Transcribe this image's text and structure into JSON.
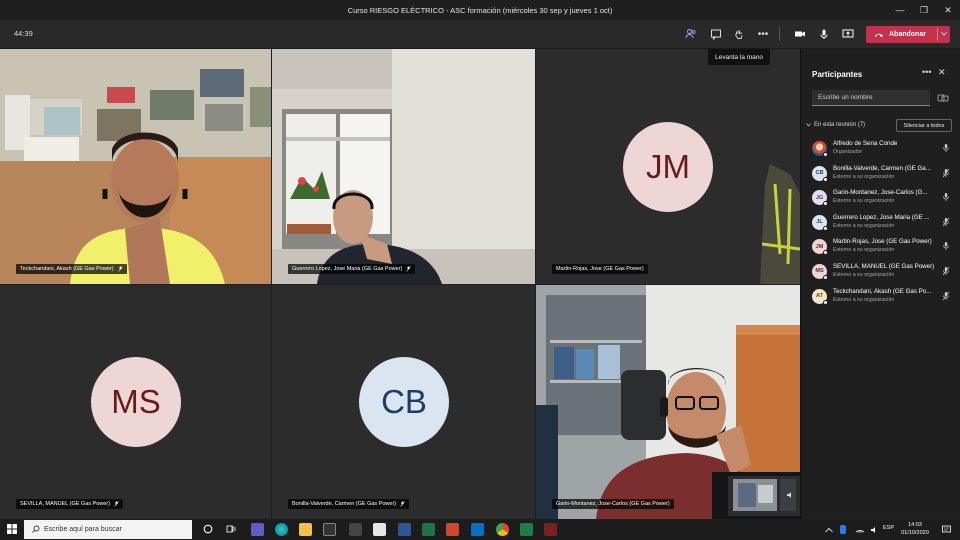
{
  "window": {
    "title": "Curso RIESGO ELÉCTRICO - ASC formación (miércoles 30 sep y jueves 1 oct)"
  },
  "toolbar": {
    "timer": "44:39",
    "leave_label": "Abandonar",
    "tooltip": "Levanta la mano"
  },
  "tiles": [
    {
      "name": "Teckchandani, Akash (GE Gas Power)",
      "type": "video"
    },
    {
      "name": "Guerrero Lopez, Jose Maria (GE Gas Power)",
      "type": "video"
    },
    {
      "name": "Martin-Rojas, Jose (GE Gas Power)",
      "type": "avatar",
      "initials": "JM"
    },
    {
      "name": "SEVILLA, MANUEL (GE Gas Power)",
      "type": "avatar",
      "initials": "MS"
    },
    {
      "name": "Bonilla-Valverde, Carmen (GE Gas Power)",
      "type": "avatar",
      "initials": "CB"
    },
    {
      "name": "Garin-Montanez, Jose-Carlos (GE Gas Power)",
      "type": "video"
    }
  ],
  "panel": {
    "title": "Participantes",
    "search_placeholder": "Escribe un nombre",
    "section_label": "En esta reunión (7)",
    "mute_all_label": "Silenciar a todos",
    "participants": [
      {
        "initials": "",
        "name": "Alfredo de Sena Conde",
        "role": "Organizador",
        "avatar_color": "#f0d9c4",
        "text_color": "#8a3a1a",
        "mic": "on"
      },
      {
        "initials": "CB",
        "name": "Bonilla-Valverde, Carmen (GE Ga...",
        "role": "Externo a su organización",
        "avatar_color": "#dbe5f1",
        "text_color": "#1b3d67",
        "mic": "off"
      },
      {
        "initials": "JG",
        "name": "Garin-Montanez, Jose-Carlos (G...",
        "role": "Externo a su organización",
        "avatar_color": "#e4dcf0",
        "text_color": "#4b2f7a",
        "mic": "on"
      },
      {
        "initials": "JL",
        "name": "Guerrero Lopez, Jose Maria (GE ...",
        "role": "Externo a su organización",
        "avatar_color": "#dbe5f1",
        "text_color": "#1b3d67",
        "mic": "off"
      },
      {
        "initials": "JM",
        "name": "Martin-Rojas, Jose (GE Gas Power)",
        "role": "Externo a su organización",
        "avatar_color": "#efd6d6",
        "text_color": "#6b1a1a",
        "mic": "on"
      },
      {
        "initials": "MS",
        "name": "SEVILLA, MANUEL (GE Gas Power)",
        "role": "Externo a su organización",
        "avatar_color": "#efd6d6",
        "text_color": "#6b1a1a",
        "mic": "off"
      },
      {
        "initials": "AT",
        "name": "Teckchandani, Akash (GE Gas Po...",
        "role": "Externo a su organización",
        "avatar_color": "#f3e6c9",
        "text_color": "#6b4a0a",
        "mic": "off"
      }
    ]
  },
  "taskbar": {
    "search_placeholder": "Escribe aquí para buscar",
    "time": "14:03",
    "date": "01/10/2020"
  },
  "colors": {
    "leave": "#c4314b",
    "avatar_pink": "#efd6d6",
    "avatar_blue": "#dbe5f1"
  }
}
